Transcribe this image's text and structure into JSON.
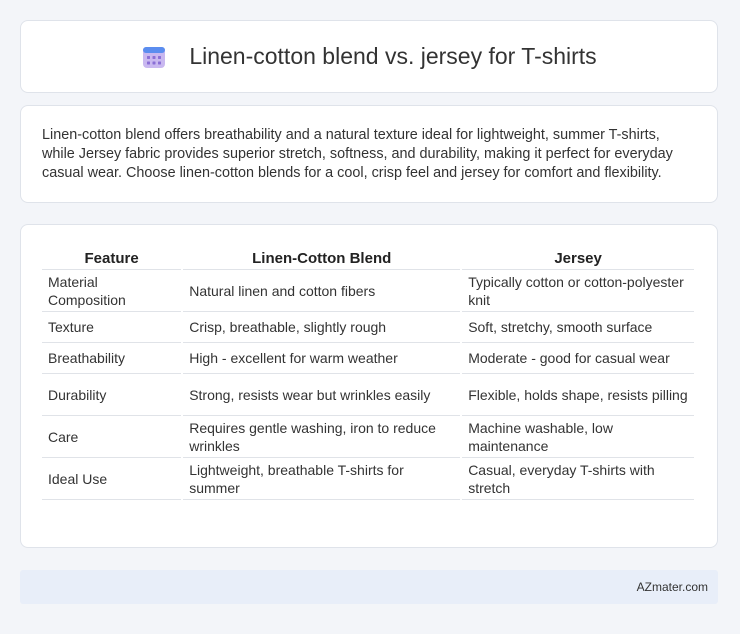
{
  "header": {
    "title": "Linen-cotton blend vs. jersey for T-shirts",
    "icon": "calendar-icon"
  },
  "summary": {
    "text": "Linen-cotton blend offers breathability and a natural texture ideal for lightweight, summer T-shirts, while Jersey fabric provides superior stretch, softness, and durability, making it perfect for everyday casual wear. Choose linen-cotton blends for a cool, crisp feel and jersey for comfort and flexibility."
  },
  "table": {
    "headers": [
      "Feature",
      "Linen-Cotton Blend",
      "Jersey"
    ],
    "rows": [
      [
        "Material Composition",
        "Natural linen and cotton fibers",
        "Typically cotton or cotton-polyester knit"
      ],
      [
        "Texture",
        "Crisp, breathable, slightly rough",
        "Soft, stretchy, smooth surface"
      ],
      [
        "Breathability",
        "High - excellent for warm weather",
        "Moderate - good for casual wear"
      ],
      [
        "Durability",
        "Strong, resists wear but wrinkles easily",
        "Flexible, holds shape, resists pilling"
      ],
      [
        "Care",
        "Requires gentle washing, iron to reduce wrinkles",
        "Machine washable, low maintenance"
      ],
      [
        "Ideal Use",
        "Lightweight, breathable T-shirts for summer",
        "Casual, everyday T-shirts with stretch"
      ]
    ]
  },
  "footer": {
    "brand": "AZmater.com"
  },
  "colors": {
    "background": "#f3f5f9",
    "card": "#ffffff",
    "footer": "#e8eef9",
    "icon_accent": "#8b6fd6"
  }
}
